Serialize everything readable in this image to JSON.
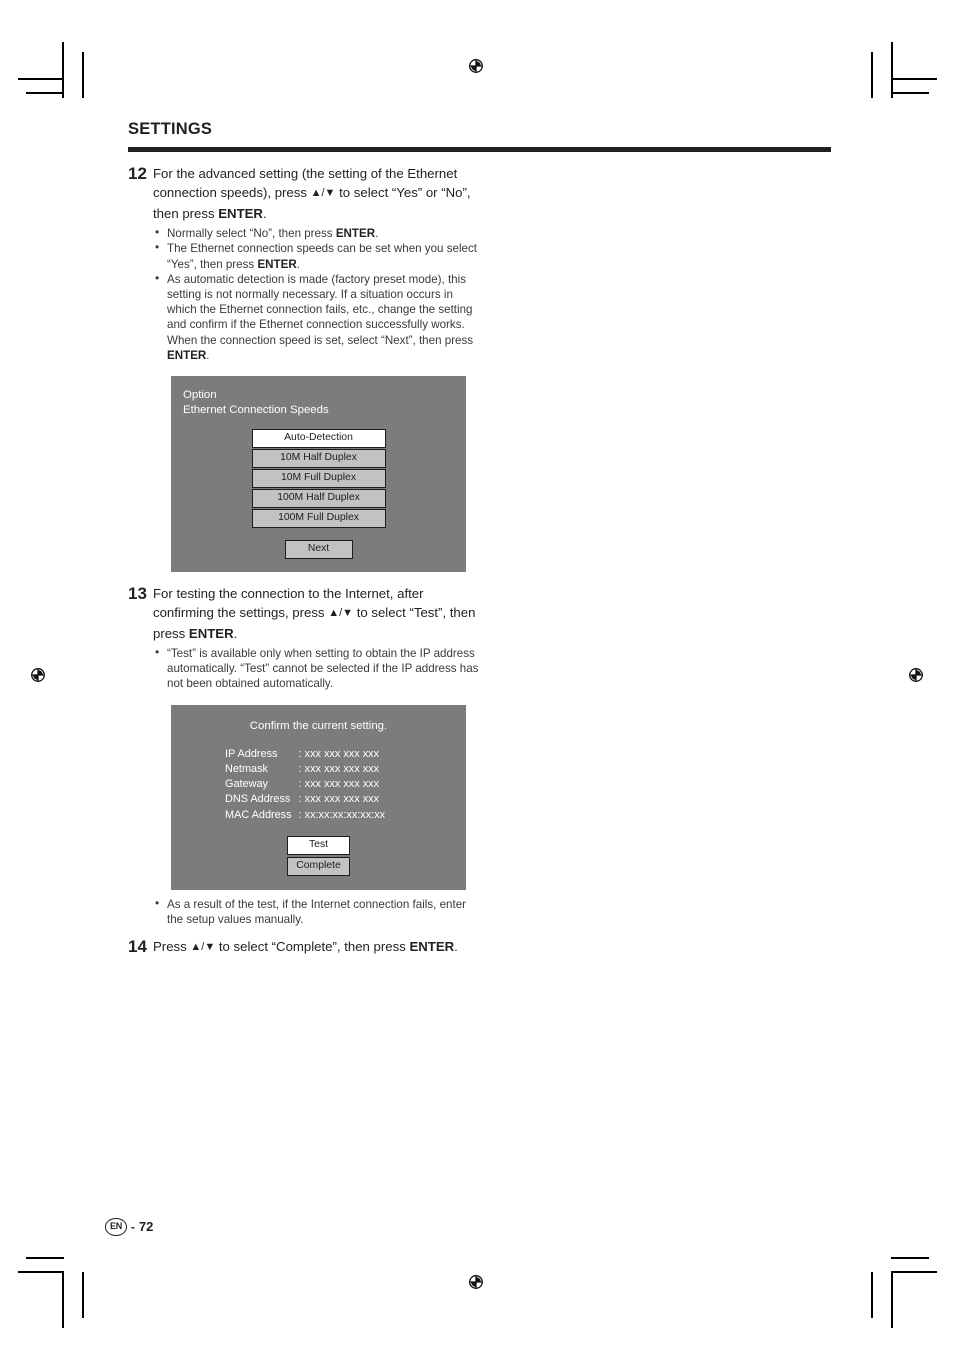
{
  "document": {
    "section_title": "SETTINGS",
    "page_label": "EN",
    "page_separator": "-",
    "page_number": "72"
  },
  "steps": [
    {
      "number": "12",
      "lead_parts": [
        "For the advanced setting (the setting of the Ethernet connection speeds), press ",
        "▲/▼",
        " to select “Yes” or “No”, then press ",
        "ENTER",
        "."
      ],
      "bullets": [
        {
          "text_1": "Normally select “No”, then press ",
          "bold": "ENTER",
          "text_2": "."
        },
        {
          "text_1": "The Ethernet connection speeds can be set when you select “Yes”, then press ",
          "bold": "ENTER",
          "text_2": "."
        },
        {
          "text_1": "As automatic detection is made (factory preset mode), this setting is not normally necessary. If a situation occurs in which the Ethernet connection fails, etc., change the setting and confirm if the Ethernet connection successfully works.",
          "bold": "",
          "text_2": ""
        },
        {
          "text_1": "When the connection speed is set, select “Next”, then press ",
          "bold": "ENTER",
          "text_2": ".",
          "nobullet": true
        }
      ]
    },
    {
      "number": "13",
      "lead_parts": [
        "For testing the connection to the Internet, after confirming the settings, press ",
        "▲/▼",
        " to select “Test”, then press ",
        "ENTER",
        "."
      ],
      "bullets": [
        {
          "text_1": "“Test” is available only when setting to obtain the IP address automatically. “Test” cannot be selected if the IP address has not been obtained automatically.",
          "bold": "",
          "text_2": ""
        }
      ]
    },
    {
      "number": "14",
      "lead_parts": [
        "Press ",
        "▲/▼",
        " to select “Complete”, then press ",
        "ENTER",
        "."
      ],
      "bullets": []
    }
  ],
  "screen_option": {
    "title_line_1": "Option",
    "title_line_2": "Ethernet Connection Speeds",
    "buttons": [
      {
        "label": "Auto-Detection",
        "selected": true
      },
      {
        "label": "10M Half Duplex",
        "selected": false
      },
      {
        "label": "10M Full Duplex",
        "selected": false
      },
      {
        "label": "100M Half Duplex",
        "selected": false
      },
      {
        "label": "100M Full Duplex",
        "selected": false
      }
    ],
    "next_button": {
      "label": "Next",
      "selected": false
    }
  },
  "screen_confirm": {
    "heading": "Confirm the current setting.",
    "rows": [
      {
        "label": "IP Address",
        "separator": ":",
        "value": "xxx xxx xxx xxx"
      },
      {
        "label": "Netmask",
        "separator": ":",
        "value": "xxx xxx xxx xxx"
      },
      {
        "label": "Gateway",
        "separator": ":",
        "value": "xxx xxx xxx xxx"
      },
      {
        "label": "DNS Address",
        "separator": ":",
        "value": "xxx xxx xxx xxx"
      },
      {
        "label": "MAC Address",
        "separator": ":",
        "value": "xx:xx:xx:xx:xx:xx"
      }
    ],
    "buttons": [
      {
        "label": "Test",
        "selected": true
      },
      {
        "label": "Complete",
        "selected": false
      }
    ]
  },
  "after_confirm_note": "As a result of the test, if the Internet connection fails, enter the setup values manually.",
  "colors": {
    "screen_bg": "#7c7c7c",
    "button_bg": "#c2c2c2",
    "button_selected_bg": "#ffffff",
    "ink": "#231f20"
  }
}
